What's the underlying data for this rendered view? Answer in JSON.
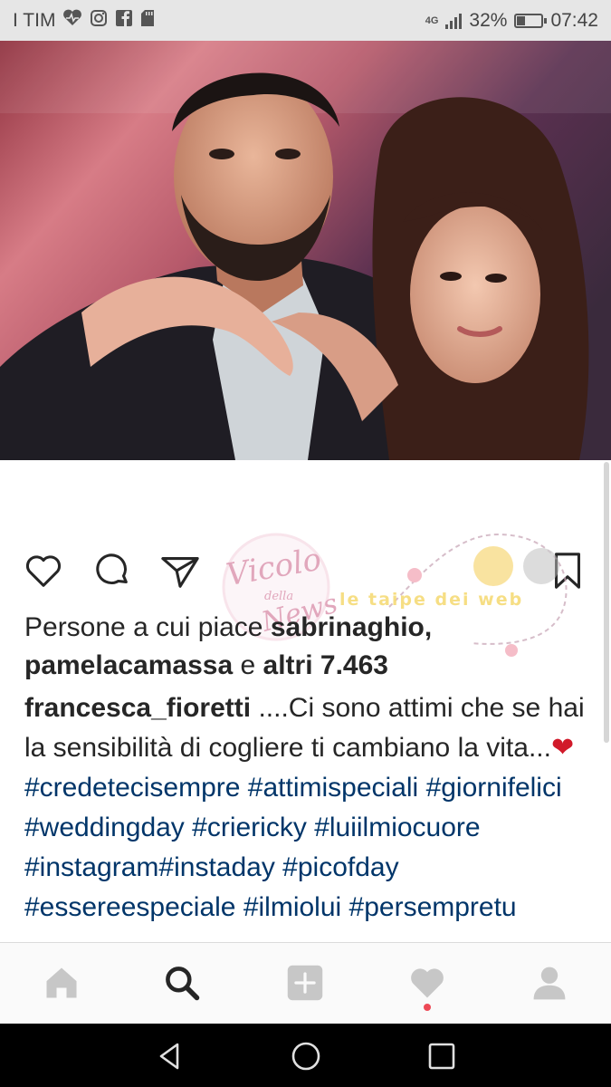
{
  "status_bar": {
    "carrier": "I TIM",
    "network": "4G",
    "battery": "32%",
    "battery_level": 0.32,
    "time": "07:42",
    "left_icons": [
      "heart-pulse-icon",
      "instagram-icon",
      "facebook-icon",
      "sd-card-icon"
    ]
  },
  "post": {
    "photo_alt": "couple photo",
    "actions": [
      "like-icon",
      "comment-icon",
      "share-icon",
      "bookmark-icon"
    ],
    "likes": {
      "prefix": "Persone a cui piace ",
      "user1": "sabrinaghio",
      "sep": ",",
      "user2": "pamelacamassa",
      "conj": " e ",
      "others": "altri 7.463"
    },
    "caption": {
      "author": "francesca_fioretti",
      "text": " ....Ci sono attimi che se hai la sensibilità di cogliere ti cambiano la vita...",
      "emoji": "❤",
      "tag1": "#credetecisempre",
      "tag2": "#attimispeciali",
      "tag3": "#giornifelici",
      "tag4": "#weddingday",
      "tag5": "#criericky",
      "tag6": "#luiilmiocuore",
      "tag7": "#instagram#instaday",
      "tag8": "#picofday",
      "tag9": "#essereespeciale #ilmiolui #persempretu"
    }
  },
  "watermark": {
    "line1": "Vicolo",
    "line2": "della",
    "line3": "News",
    "line4": "le taipe dei web"
  },
  "bottom_nav": [
    "home-icon",
    "search-icon",
    "add-icon",
    "activity-icon",
    "profile-icon"
  ],
  "colors": {
    "hashtag": "#003569",
    "text": "#262626",
    "notif": "#ed4956",
    "statusbar": "#e6e6e6"
  }
}
